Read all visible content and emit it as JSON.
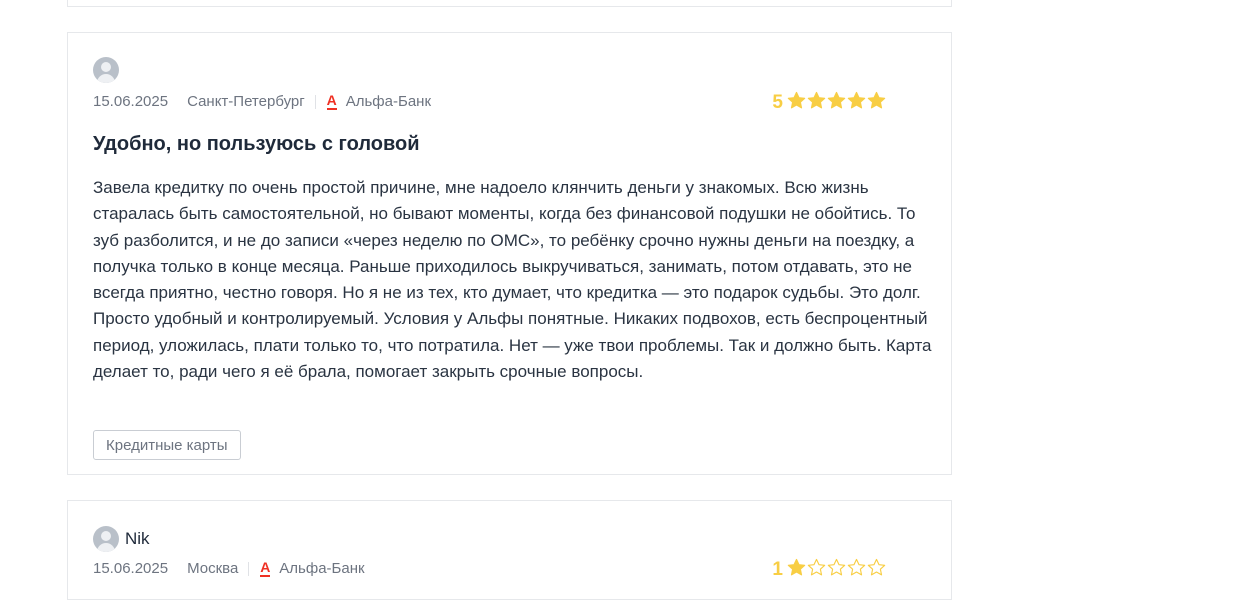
{
  "reviews": [
    {
      "author": "",
      "date": "15.06.2025",
      "city": "Санкт-Петербург",
      "bank": "Альфа-Банк",
      "bank_logo": "А",
      "rating": 5,
      "rating_label": "5",
      "title": "Удобно, но пользуюсь с головой",
      "text": "Завела кредитку по очень простой причине, мне надоело клянчить деньги у знакомых. Всю жизнь старалась быть самостоятельной, но бывают моменты, когда без финансовой подушки не обойтись. То зуб разболится, и не до записи «через неделю по ОМС», то ребёнку срочно нужны деньги на поездку, а получка только в конце месяца. Раньше приходилось выкручиваться, занимать, потом отдавать, это не всегда приятно, честно говоря. Но я не из тех, кто думает, что кредитка — это подарок судьбы. Это долг. Просто удобный и контролируемый. Условия у Альфы понятные. Никаких подвохов, есть беспроцентный период, уложилась, плати только то, что потратила. Нет — уже твои проблемы. Так и должно быть. Карта делает то, ради чего я её брала, помогает закрыть срочные вопросы.",
      "tag": "Кредитные карты"
    },
    {
      "author": "Nik",
      "date": "15.06.2025",
      "city": "Москва",
      "bank": "Альфа-Банк",
      "bank_logo": "А",
      "rating": 1,
      "rating_label": "1"
    }
  ],
  "colors": {
    "star_filled": "#f8ce44",
    "star_empty": "#f8ce44",
    "bank_red": "#ef3124",
    "border": "#e6e8eb"
  },
  "icons": {
    "avatar": "user-avatar-icon",
    "star": "star-icon",
    "bank": "alfa-bank-logo"
  }
}
